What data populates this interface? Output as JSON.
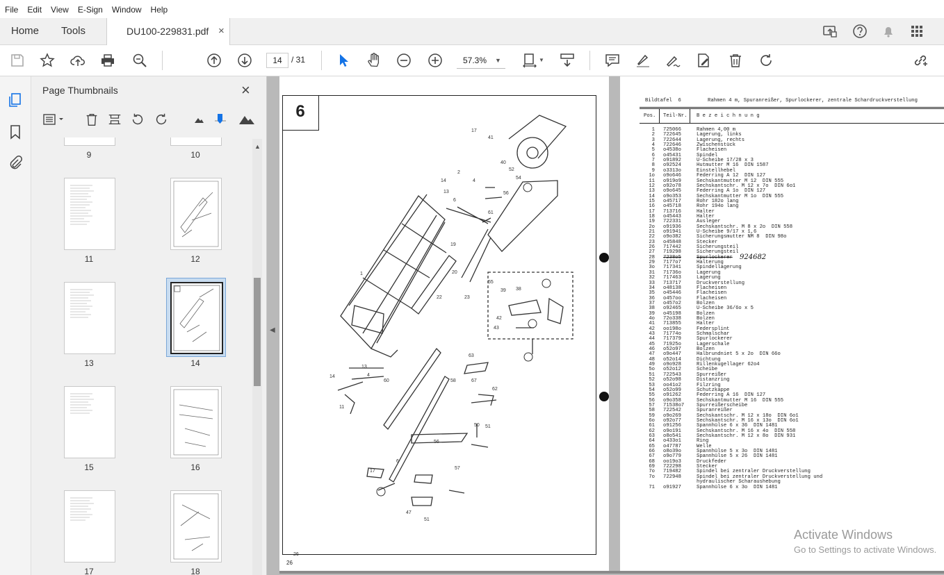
{
  "menu": [
    "File",
    "Edit",
    "View",
    "E-Sign",
    "Window",
    "Help"
  ],
  "tabs": {
    "home": "Home",
    "tools": "Tools",
    "document": "DU100-229831.pdf",
    "close": "×"
  },
  "toolbar": {
    "page_current": "14",
    "page_total": "/ 31",
    "zoom": "57.3%"
  },
  "panel": {
    "title": "Page Thumbnails",
    "close": "×",
    "thumbnails": [
      {
        "label": "9"
      },
      {
        "label": "10"
      },
      {
        "label": "11"
      },
      {
        "label": "12"
      },
      {
        "label": "13"
      },
      {
        "label": "14"
      },
      {
        "label": "15"
      },
      {
        "label": "16"
      },
      {
        "label": "17"
      },
      {
        "label": "18"
      }
    ],
    "selected": "14"
  },
  "left_page": {
    "plate_number": "6",
    "page_number": "26",
    "circled_labels": [
      "①",
      "②",
      "⑳",
      "㉓",
      "⑳"
    ]
  },
  "right_page": {
    "header_left": "Bildtafel  6",
    "header_title": "Rahmen 4 m, Spuranreißer, Spurlockerer, zentrale Schardruckverstellung",
    "col_pos": "Pos.",
    "col_part": "Teil-Nr.",
    "col_desc": "B e z e i c h n u n g",
    "handwritten_note": "924682",
    "rows": [
      [
        "1",
        "725066",
        "Rahmen 4,00 m"
      ],
      [
        "2",
        "722645",
        "Lagerung, links"
      ],
      [
        "3",
        "722644",
        "Lagerung, rechts"
      ],
      [
        "4",
        "722646",
        "Zwischenstück"
      ],
      [
        "5",
        "o4538o",
        "Flacheisen"
      ],
      [
        "6",
        "o45431",
        "Spindel"
      ],
      [
        "7",
        "o91892",
        "U-Scheibe 17/28 x 3"
      ],
      [
        "8",
        "o92524",
        "Hutmutter M 16  DIN 1587"
      ],
      [
        "9",
        "o3313o",
        "Einstellhebel"
      ],
      [
        "1o",
        "o9o646",
        "Federring A 12  DIN 127"
      ],
      [
        "11",
        "o919o9",
        "Sechskantmutter M 12  DIN 555"
      ],
      [
        "12",
        "o92o78",
        "Sechskantschr. M 12 x 7o  DIN 6o1"
      ],
      [
        "13",
        "o9o645",
        "Federring A 1o  DIN 127"
      ],
      [
        "14",
        "o9o353",
        "Sechskantmutter M 1o  DIN 555"
      ],
      [
        "15",
        "o45717",
        "Rohr 182o lang"
      ],
      [
        "16",
        "o45718",
        "Rohr 194o lang"
      ],
      [
        "17",
        "713716",
        "Halter"
      ],
      [
        "18",
        "o45443",
        "Halter"
      ],
      [
        "19",
        "722331",
        "Ausleger"
      ],
      [
        "2o",
        "o91936",
        "Sechskantschr. M 8 x 2o  DIN 558"
      ],
      [
        "21",
        "o91941",
        "U-Scheibe 9/17 x 1,6"
      ],
      [
        "22",
        "o9o382",
        "Sicherungsmutter NM 8  DIN 98o"
      ],
      [
        "23",
        "o45848",
        "Stecker"
      ],
      [
        "26",
        "717442",
        "Sicherungsteil"
      ],
      [
        "27",
        "719298",
        "Sicherungsteil"
      ],
      [
        "28",
        "7238o5",
        "Spurlockerer"
      ],
      [
        "29",
        "7177o7",
        "Halterung"
      ],
      [
        "3o",
        "717341",
        "Spindellagerung"
      ],
      [
        "31",
        "71736o",
        "Lagerung"
      ],
      [
        "32",
        "717463",
        "Lagerung"
      ],
      [
        "33",
        "713717",
        "Druckverstellung"
      ],
      [
        "34",
        "o48138",
        "Flacheisen"
      ],
      [
        "35",
        "o45446",
        "Flacheisen"
      ],
      [
        "36",
        "o457oo",
        "Flacheisen"
      ],
      [
        "37",
        "o457o2",
        "Bolzen"
      ],
      [
        "38",
        "o92465",
        "U-Scheibe 36/6o x 5"
      ],
      [
        "39",
        "o45198",
        "Bolzen"
      ],
      [
        "4o",
        "72o338",
        "Bolzen"
      ],
      [
        "41",
        "713855",
        "Halter"
      ],
      [
        "42",
        "oo198o",
        "Federsplint"
      ],
      [
        "43",
        "71774o",
        "Schmalschar"
      ],
      [
        "44",
        "717379",
        "Spurlockerer"
      ],
      [
        "45",
        "71925o",
        "Lagerschale"
      ],
      [
        "46",
        "o52o97",
        "Bolzen"
      ],
      [
        "47",
        "o9o447",
        "Halbrundniet 5 x 2o  DIN 66o"
      ],
      [
        "48",
        "o52o14",
        "Dichtung"
      ],
      [
        "49",
        "o9o928",
        "Rillenkugellager 62o4"
      ],
      [
        "5o",
        "o52o12",
        "Scheibe"
      ],
      [
        "51",
        "722543",
        "Spurreißer"
      ],
      [
        "52",
        "o52o98",
        "Distanzring"
      ],
      [
        "53",
        "oo41o2",
        "Filzring"
      ],
      [
        "54",
        "o52o99",
        "Schutzkappe"
      ],
      [
        "55",
        "o91262",
        "Federring A 16  DIN 127"
      ],
      [
        "56",
        "o9o358",
        "Sechskantmutter M 16  DIN 555"
      ],
      [
        "57",
        "71538o7",
        "Spurreißerscheibe"
      ],
      [
        "58",
        "722542",
        "Spuranreißer"
      ],
      [
        "59",
        "o9o269",
        "Sechskantschr. M 12 x 18o  DIN 6o1"
      ],
      [
        "6o",
        "o92o77",
        "Sechskantschr. M 16 x 13o  DIN 6o1"
      ],
      [
        "61",
        "o91256",
        "Spannhülse 6 x 36  DIN 1481"
      ],
      [
        "62",
        "o9o191",
        "Sechskantschr. M 16 x 4o  DIN 558"
      ],
      [
        "63",
        "o8o541",
        "Sechskantschr. M 12 x 8o  DIN 931"
      ],
      [
        "64",
        "o433o1",
        "Ring"
      ],
      [
        "65",
        "o47787",
        "Welle"
      ],
      [
        "66",
        "o8o39o",
        "Spannhülse 5 x 3o  DIN 1481"
      ],
      [
        "67",
        "o9o779",
        "Spannhülse 5 x 26  DIN 1481"
      ],
      [
        "68",
        "oo19o3",
        "Druckfeder"
      ],
      [
        "69",
        "722298",
        "Stecker"
      ],
      [
        "7o",
        "719482",
        "Spindel bei zentraler Druckverstellung"
      ],
      [
        "7o",
        "722948",
        "Spindel bei zentraler Druckverstellung und"
      ],
      [
        "",
        "",
        "hydraulischer Scharaushebung"
      ],
      [
        "71",
        "o91927",
        "Spannhülse 6 x 3o  DIN 1481"
      ]
    ]
  },
  "watermark": {
    "line1": "Activate Windows",
    "line2": "Go to Settings to activate Windows."
  }
}
